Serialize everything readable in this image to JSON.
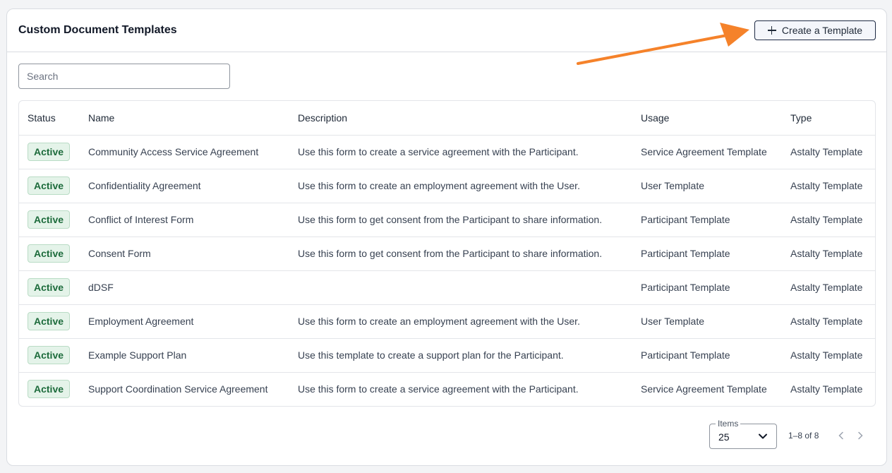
{
  "header": {
    "title": "Custom Document Templates",
    "create_label": "Create a Template"
  },
  "search": {
    "placeholder": "Search",
    "value": ""
  },
  "table": {
    "columns": [
      "Status",
      "Name",
      "Description",
      "Usage",
      "Type"
    ],
    "rows": [
      {
        "status": "Active",
        "name": "Community Access Service Agreement",
        "description": "Use this form to create a service agreement with the Participant.",
        "usage": "Service Agreement Template",
        "type": "Astalty Template"
      },
      {
        "status": "Active",
        "name": "Confidentiality Agreement",
        "description": "Use this form to create an employment agreement with the User.",
        "usage": "User Template",
        "type": "Astalty Template"
      },
      {
        "status": "Active",
        "name": "Conflict of Interest Form",
        "description": "Use this form to get consent from the Participant to share information.",
        "usage": "Participant Template",
        "type": "Astalty Template"
      },
      {
        "status": "Active",
        "name": "Consent Form",
        "description": "Use this form to get consent from the Participant to share information.",
        "usage": "Participant Template",
        "type": "Astalty Template"
      },
      {
        "status": "Active",
        "name": "dDSF",
        "description": "",
        "usage": "Participant Template",
        "type": "Astalty Template"
      },
      {
        "status": "Active",
        "name": "Employment Agreement",
        "description": "Use this form to create an employment agreement with the User.",
        "usage": "User Template",
        "type": "Astalty Template"
      },
      {
        "status": "Active",
        "name": "Example Support Plan",
        "description": "Use this template to create a support plan for the Participant.",
        "usage": "Participant Template",
        "type": "Astalty Template"
      },
      {
        "status": "Active",
        "name": "Support Coordination Service Agreement",
        "description": "Use this form to create a service agreement with the Participant.",
        "usage": "Service Agreement Template",
        "type": "Astalty Template"
      }
    ]
  },
  "pagination": {
    "items_label": "Items",
    "items_value": "25",
    "range_text": "1–8 of 8"
  },
  "colors": {
    "active_badge_bg": "#e4f3e9",
    "active_badge_text": "#1c6b3b",
    "annotation_arrow": "#f5822a"
  },
  "icons": [
    "plus-icon",
    "chevron-down-icon",
    "chevron-left-icon",
    "chevron-right-icon",
    "annotation-arrow"
  ]
}
